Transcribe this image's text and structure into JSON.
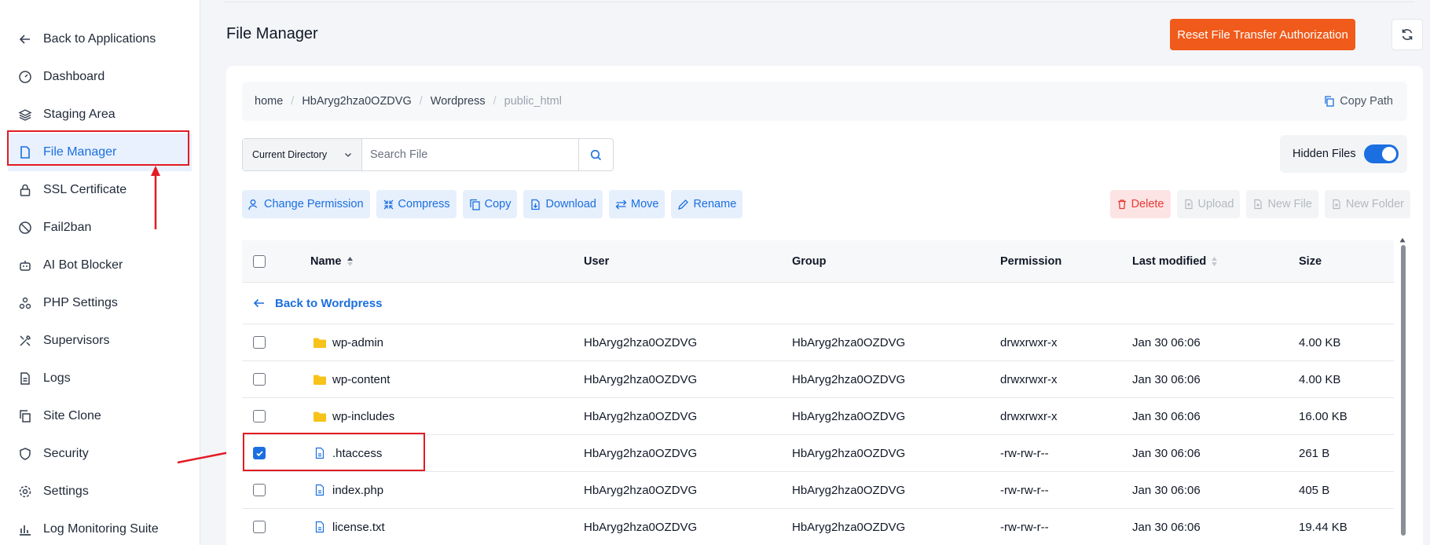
{
  "sidebar": {
    "items": [
      {
        "label": "Back to Applications",
        "icon": "arrow-left-icon"
      },
      {
        "label": "Dashboard",
        "icon": "gauge-icon"
      },
      {
        "label": "Staging Area",
        "icon": "layers-icon"
      },
      {
        "label": "File Manager",
        "icon": "file-icon",
        "active": true
      },
      {
        "label": "SSL Certificate",
        "icon": "lock-icon"
      },
      {
        "label": "Fail2ban",
        "icon": "ban-icon"
      },
      {
        "label": "AI Bot Blocker",
        "icon": "robot-icon"
      },
      {
        "label": "PHP Settings",
        "icon": "cluster-icon"
      },
      {
        "label": "Supervisors",
        "icon": "tools-icon"
      },
      {
        "label": "Logs",
        "icon": "document-icon"
      },
      {
        "label": "Site Clone",
        "icon": "copy-icon"
      },
      {
        "label": "Security",
        "icon": "shield-icon"
      },
      {
        "label": "Settings",
        "icon": "gear-icon"
      },
      {
        "label": "Log Monitoring Suite",
        "icon": "bar-chart-icon"
      }
    ]
  },
  "header": {
    "title": "File Manager",
    "reset_label": "Reset File Transfer Authorization"
  },
  "breadcrumb": {
    "items": [
      "home",
      "HbAryg2hza0OZDVG",
      "Wordpress",
      "public_html"
    ],
    "copy_path_label": "Copy Path"
  },
  "search": {
    "scope": "Current Directory",
    "placeholder": "Search File"
  },
  "hidden_files": {
    "label": "Hidden Files",
    "enabled": true
  },
  "actions": {
    "left": [
      "Change Permission",
      "Compress",
      "Copy",
      "Download",
      "Move",
      "Rename"
    ],
    "right": [
      "Delete",
      "Upload",
      "New File",
      "New Folder"
    ]
  },
  "table": {
    "headers": {
      "name": "Name",
      "user": "User",
      "group": "Group",
      "permission": "Permission",
      "modified": "Last modified",
      "size": "Size"
    },
    "back_label": "Back to Wordpress",
    "rows": [
      {
        "name": "wp-admin",
        "type": "folder",
        "user": "HbAryg2hza0OZDVG",
        "group": "HbAryg2hza0OZDVG",
        "permission": "drwxrwxr-x",
        "modified": "Jan 30 06:06",
        "size": "4.00 KB",
        "checked": false
      },
      {
        "name": "wp-content",
        "type": "folder",
        "user": "HbAryg2hza0OZDVG",
        "group": "HbAryg2hza0OZDVG",
        "permission": "drwxrwxr-x",
        "modified": "Jan 30 06:06",
        "size": "4.00 KB",
        "checked": false
      },
      {
        "name": "wp-includes",
        "type": "folder",
        "user": "HbAryg2hza0OZDVG",
        "group": "HbAryg2hza0OZDVG",
        "permission": "drwxrwxr-x",
        "modified": "Jan 30 06:06",
        "size": "16.00 KB",
        "checked": false
      },
      {
        "name": ".htaccess",
        "type": "file",
        "user": "HbAryg2hza0OZDVG",
        "group": "HbAryg2hza0OZDVG",
        "permission": "-rw-rw-r--",
        "modified": "Jan 30 06:06",
        "size": "261 B",
        "checked": true
      },
      {
        "name": "index.php",
        "type": "file",
        "user": "HbAryg2hza0OZDVG",
        "group": "HbAryg2hza0OZDVG",
        "permission": "-rw-rw-r--",
        "modified": "Jan 30 06:06",
        "size": "405 B",
        "checked": false
      },
      {
        "name": "license.txt",
        "type": "file",
        "user": "HbAryg2hza0OZDVG",
        "group": "HbAryg2hza0OZDVG",
        "permission": "-rw-rw-r--",
        "modified": "Jan 30 06:06",
        "size": "19.44 KB",
        "checked": false
      }
    ]
  },
  "colors": {
    "accent": "#1b6fe0",
    "reset_button": "#f05a1a",
    "annotation": "#e31b23",
    "danger": "#e53935"
  }
}
